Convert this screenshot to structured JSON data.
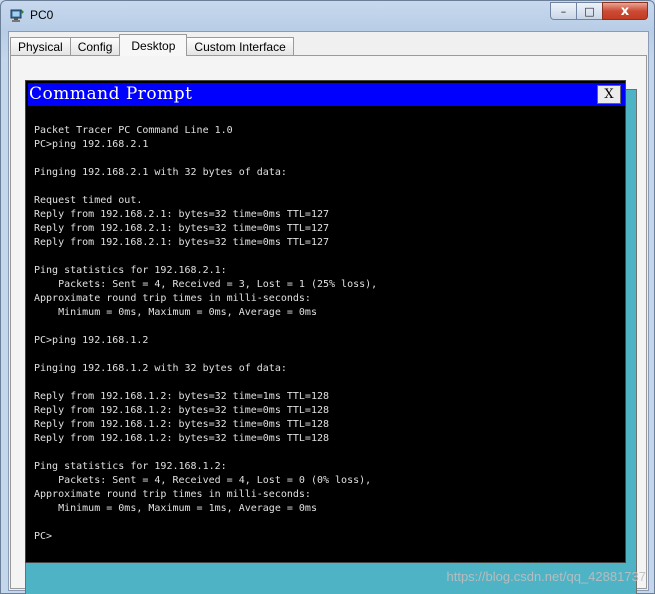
{
  "window": {
    "title": "PC0",
    "minimize_symbol": "–",
    "maximize_symbol": "□",
    "close_symbol": "x"
  },
  "tabs": [
    {
      "label": "Physical"
    },
    {
      "label": "Config"
    },
    {
      "label": "Desktop",
      "active": true
    },
    {
      "label": "Custom Interface"
    }
  ],
  "command_prompt": {
    "title": "Command Prompt",
    "close_label": "X",
    "lines": [
      "Packet Tracer PC Command Line 1.0",
      "PC>ping 192.168.2.1",
      "",
      "Pinging 192.168.2.1 with 32 bytes of data:",
      "",
      "Request timed out.",
      "Reply from 192.168.2.1: bytes=32 time=0ms TTL=127",
      "Reply from 192.168.2.1: bytes=32 time=0ms TTL=127",
      "Reply from 192.168.2.1: bytes=32 time=0ms TTL=127",
      "",
      "Ping statistics for 192.168.2.1:",
      "    Packets: Sent = 4, Received = 3, Lost = 1 (25% loss),",
      "Approximate round trip times in milli-seconds:",
      "    Minimum = 0ms, Maximum = 0ms, Average = 0ms",
      "",
      "PC>ping 192.168.1.2",
      "",
      "Pinging 192.168.1.2 with 32 bytes of data:",
      "",
      "Reply from 192.168.1.2: bytes=32 time=1ms TTL=128",
      "Reply from 192.168.1.2: bytes=32 time=0ms TTL=128",
      "Reply from 192.168.1.2: bytes=32 time=0ms TTL=128",
      "Reply from 192.168.1.2: bytes=32 time=0ms TTL=128",
      "",
      "Ping statistics for 192.168.1.2:",
      "    Packets: Sent = 4, Received = 4, Lost = 0 (0% loss),",
      "Approximate round trip times in milli-seconds:",
      "    Minimum = 0ms, Maximum = 1ms, Average = 0ms",
      "",
      "PC>"
    ]
  },
  "watermark": "https://blog.csdn.net/qq_42881737",
  "colors": {
    "prompt_title_bar": "#0000ff",
    "desktop_background": "#4fb3c6",
    "terminal_background": "#000000"
  }
}
